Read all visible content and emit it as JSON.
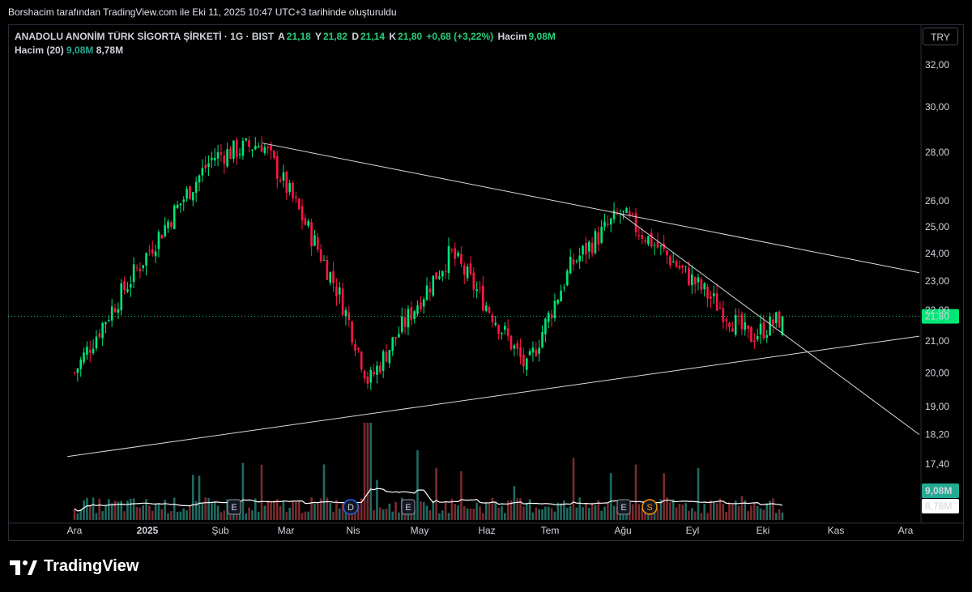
{
  "caption": "Borshacim tarafından TradingView.com ile Eki 11, 2025 10:47 UTC+3 tarihinde oluşturuldu",
  "legend": {
    "symbol": "ANADOLU ANONİM TÜRK SİGORTA ŞİRKETİ · 1G · BIST",
    "open_label": "A",
    "open": "21,18",
    "high_label": "Y",
    "high": "21,82",
    "low_label": "D",
    "low": "21,14",
    "close_label": "K",
    "close": "21,80",
    "change": "+0,68 (+3,22%)",
    "volume_label": "Hacim",
    "volume": "9,08M"
  },
  "volume_legend": {
    "label": "Hacim (20)",
    "value1": "9,08M",
    "value2": "8,78M"
  },
  "currency": "TRY",
  "brand": "TradingView",
  "colors": {
    "up": "#26a69a",
    "up_bright": "#00e676",
    "down": "#ef5350",
    "down_bright": "#ff1744",
    "ma": "#ffffff",
    "bg": "#000000"
  },
  "chart_data": {
    "type": "candlestick",
    "y_axis": {
      "scale": "log",
      "ticks": [
        "32,00",
        "30,00",
        "28,00",
        "26,00",
        "25,00",
        "24,00",
        "23,00",
        "22,00",
        "21,00",
        "20,00",
        "19,00",
        "18,20",
        "17,40"
      ]
    },
    "x_axis": {
      "ticks": [
        "Ara",
        "2025",
        "Şub",
        "Mar",
        "Nis",
        "May",
        "Haz",
        "Tem",
        "Ağu",
        "Eyl",
        "Eki",
        "Kas",
        "Ara"
      ]
    },
    "last_price": "21,80",
    "volume_labels": [
      "9,08M",
      "8,78M"
    ],
    "event_markers": [
      {
        "label": "E",
        "x_tick": "Şub"
      },
      {
        "label": "D",
        "x_tick": "Nis"
      },
      {
        "label": "E",
        "x_tick": "Nis"
      },
      {
        "label": "E",
        "x_tick": "Ağu"
      },
      {
        "label": "S",
        "x_tick": "Ağu"
      }
    ],
    "key_points": [
      {
        "date": "2024-12",
        "price": 20.0
      },
      {
        "date": "2025-01",
        "price": 24.0
      },
      {
        "date": "2025-01-28",
        "price": 27.8
      },
      {
        "date": "2025-02-20",
        "price": 28.4
      },
      {
        "date": "2025-03-25",
        "price": 22.5
      },
      {
        "date": "2025-04-08",
        "price": 19.7
      },
      {
        "date": "2025-05-15",
        "price": 24.0
      },
      {
        "date": "2025-06-20",
        "price": 20.1
      },
      {
        "date": "2025-07-10",
        "price": 23.6
      },
      {
        "date": "2025-07-30",
        "price": 25.5
      },
      {
        "date": "2025-09-25",
        "price": 21.1
      },
      {
        "date": "2025-10-10",
        "price": 21.8
      }
    ],
    "trendlines": [
      {
        "from": {
          "date": "2025-02-20",
          "price": 28.4
        },
        "to": {
          "date": "2025-12-31",
          "price": 23.3
        }
      },
      {
        "from": {
          "date": "2024-11-28",
          "price": 17.6
        },
        "to": {
          "date": "2025-12-31",
          "price": 21.15
        }
      },
      {
        "from": {
          "date": "2025-07-30",
          "price": 25.5
        },
        "to": {
          "date": "2025-12-31",
          "price": 18.2
        }
      }
    ]
  }
}
